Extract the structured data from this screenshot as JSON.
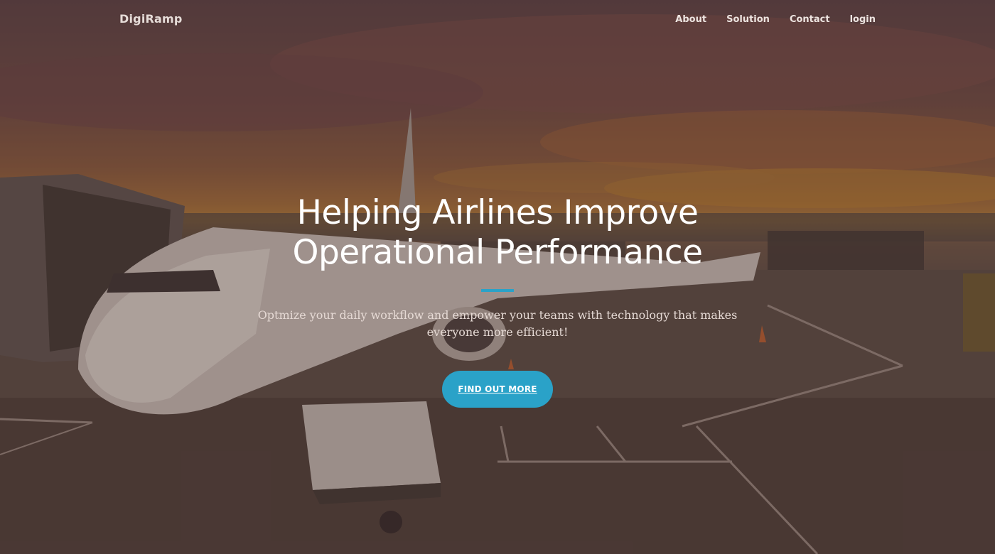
{
  "navbar": {
    "brand": "DigiRamp",
    "links": [
      {
        "label": "About"
      },
      {
        "label": "Solution"
      },
      {
        "label": "Contact"
      },
      {
        "label": "login"
      }
    ]
  },
  "hero": {
    "headline_line1": "Helping Airlines Improve",
    "headline_line2": "Operational Performance",
    "subtext": "Optmize your daily workflow and empower your teams with technology that makes everyone more efficient!",
    "cta_label": "FIND OUT MORE",
    "background_image": "airplane-at-gate-sunset"
  },
  "colors": {
    "accent": "#2aa2c8",
    "overlay": "#462d28",
    "heading_text": "#ffffff"
  }
}
